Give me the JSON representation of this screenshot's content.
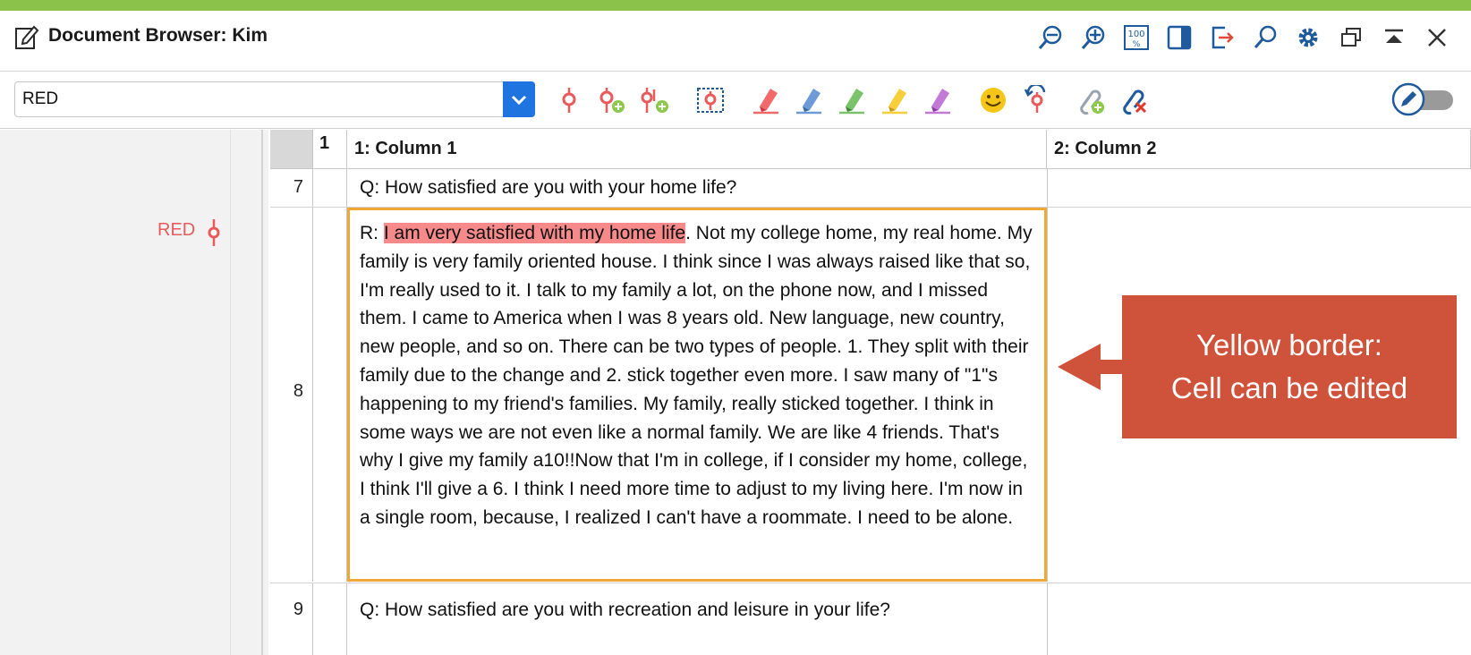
{
  "window": {
    "title": "Document Browser: Kim",
    "title_icons": [
      "zoom-out-icon",
      "zoom-in-icon",
      "zoom-100-icon",
      "panel-toggle-icon",
      "export-icon",
      "search-icon",
      "gear-icon",
      "undock-icon",
      "collapse-icon",
      "close-icon"
    ]
  },
  "toolbar": {
    "code_select_value": "RED",
    "icons": [
      "code-icon",
      "code-add-icon",
      "code-in-vivo-icon",
      "code-area-icon",
      "highlight-red-icon",
      "highlight-blue-icon",
      "highlight-green-icon",
      "highlight-yellow-icon",
      "highlight-purple-icon",
      "emoticon-icon",
      "undo-code-icon",
      "link-add-icon",
      "link-remove-icon"
    ],
    "highlight_colors": [
      "#f06a6a",
      "#6e9bd6",
      "#7ac36a",
      "#f6cf3a",
      "#c27ad6"
    ],
    "edit_mode_toggle": "off"
  },
  "margin": {
    "codes": [
      {
        "label": "RED",
        "color": "#ea5a5a"
      }
    ]
  },
  "table": {
    "corner_number": "1",
    "columns": [
      "1: Column 1",
      "2: Column 2"
    ],
    "rows": [
      {
        "num": "7",
        "col1": "Q: How satisfied are you with your home life?",
        "col2": ""
      },
      {
        "num": "8",
        "col1_prefix": "R: ",
        "col1_highlight": "I am very satisfied with my home life",
        "col1_rest": ". Not my college home, my real home. My family is very family oriented house. I think since I was always raised like that so, I'm really used to it. I talk to my family a lot, on the phone now, and I missed them. I came to America when I was 8 years old. New language, new country, new people, and so on. There can be two types of people. 1. They split with their family due to the change and 2. stick together even more. I saw many of \"1\"s happening to my friend's families. My family, really sticked together. I think in some ways we are not even like a normal family. We are like 4 friends. That's why I give my family a10!!Now that I'm in college, if I consider my home, college, I think I'll give a 6. I think I need more time to adjust to my living here. I'm now in a single room, because, I realized I can't have a roommate. I need to be alone.",
        "col2": ""
      },
      {
        "num": "9",
        "col1": "Q: How satisfied are you with recreation and leisure in your life?",
        "col2": ""
      }
    ]
  },
  "callout": {
    "line1": "Yellow border:",
    "line2": "Cell can be edited",
    "color": "#cf533b",
    "border_color": "#f0a73a"
  }
}
